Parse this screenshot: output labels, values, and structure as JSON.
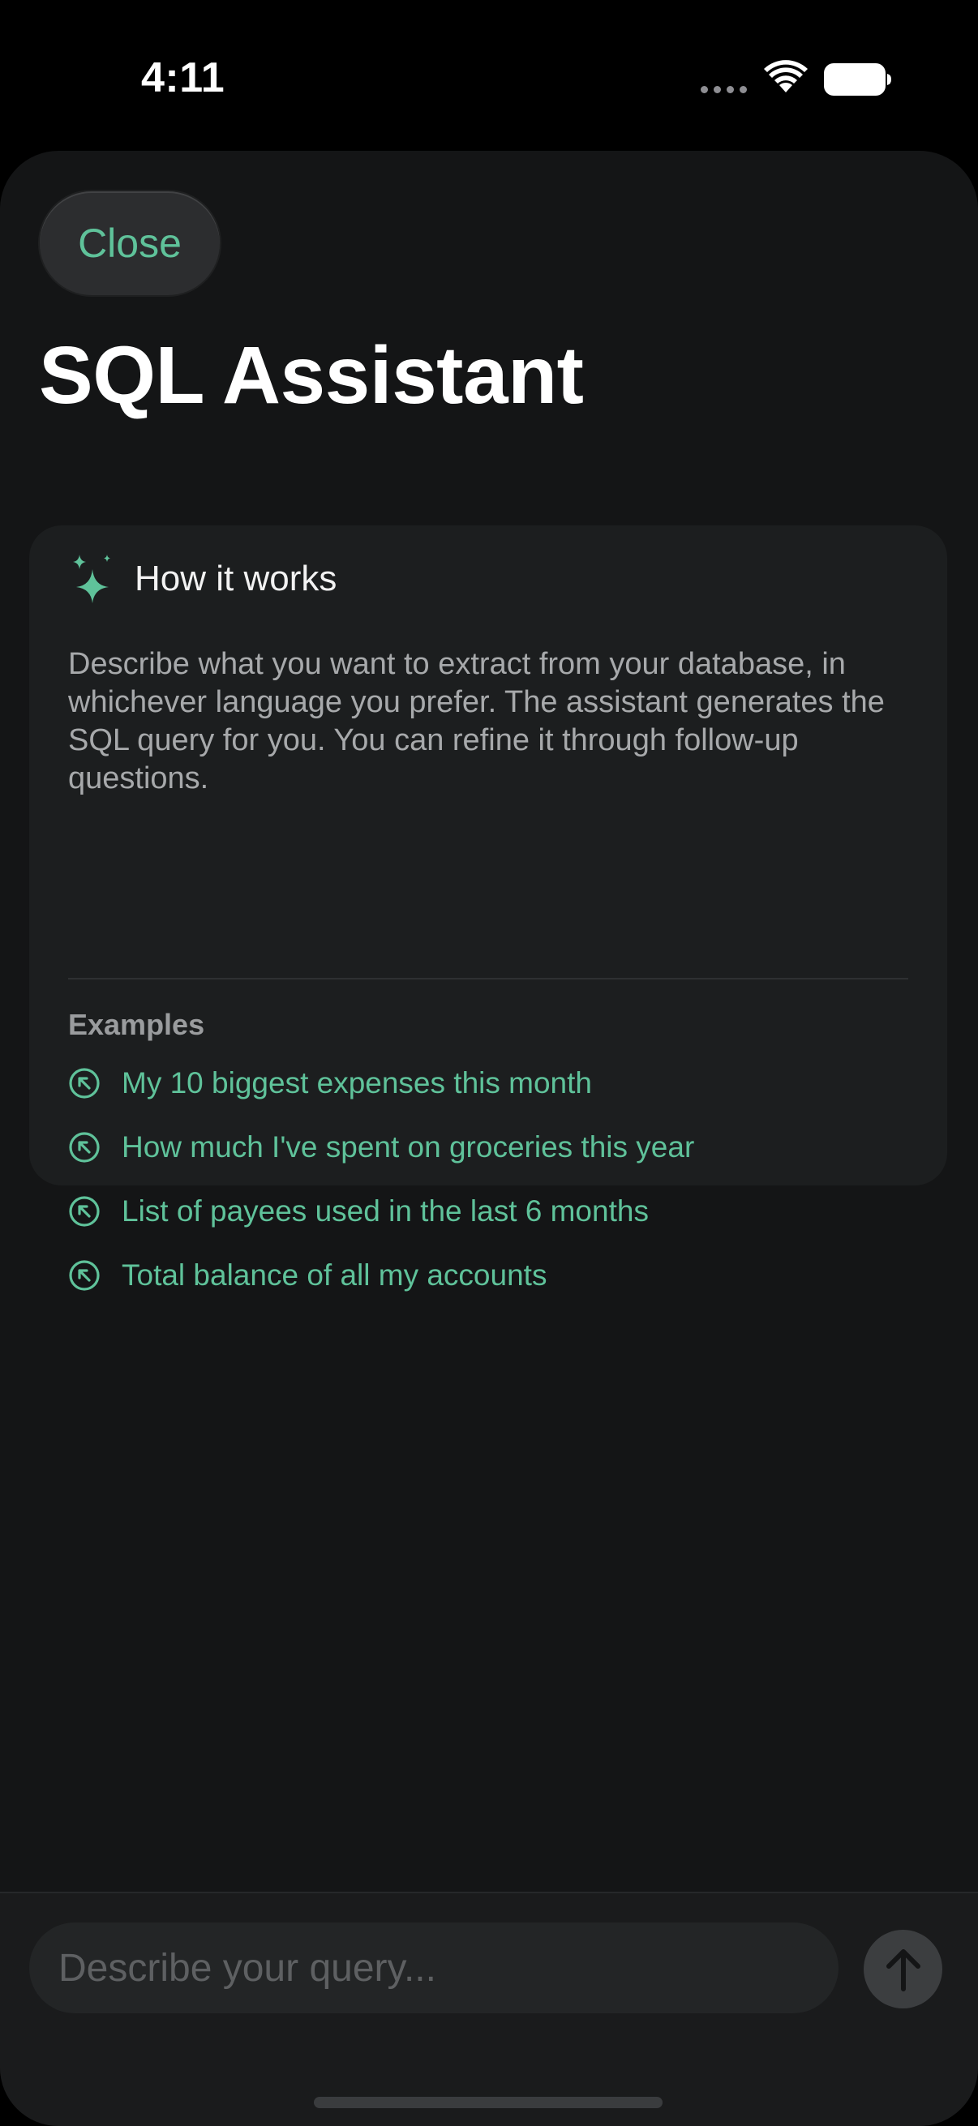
{
  "status_bar": {
    "time": "4:11"
  },
  "header": {
    "close_label": "Close",
    "title": "SQL Assistant"
  },
  "info_card": {
    "title": "How it works",
    "description": "Describe what you want to extract from your database, in whichever language you prefer. The assistant generates the SQL query for you. You can refine it through follow-up questions.",
    "examples_heading": "Examples",
    "examples": [
      {
        "label": "My 10 biggest expenses this month"
      },
      {
        "label": "How much I've spent on groceries this year"
      },
      {
        "label": "List of payees used in the last 6 months"
      },
      {
        "label": "Total balance of all my accounts"
      }
    ]
  },
  "composer": {
    "placeholder": "Describe your query..."
  },
  "icons": {
    "card_icon": "sparkles-icon",
    "example_icon": "arrow-up-left-circle-icon",
    "send_icon": "arrow-up-icon"
  },
  "colors": {
    "accent": "#5fc29a",
    "background": "#141516",
    "card": "#1c1e1f",
    "text_primary": "#ffffff",
    "text_secondary": "#a7a9ab"
  }
}
